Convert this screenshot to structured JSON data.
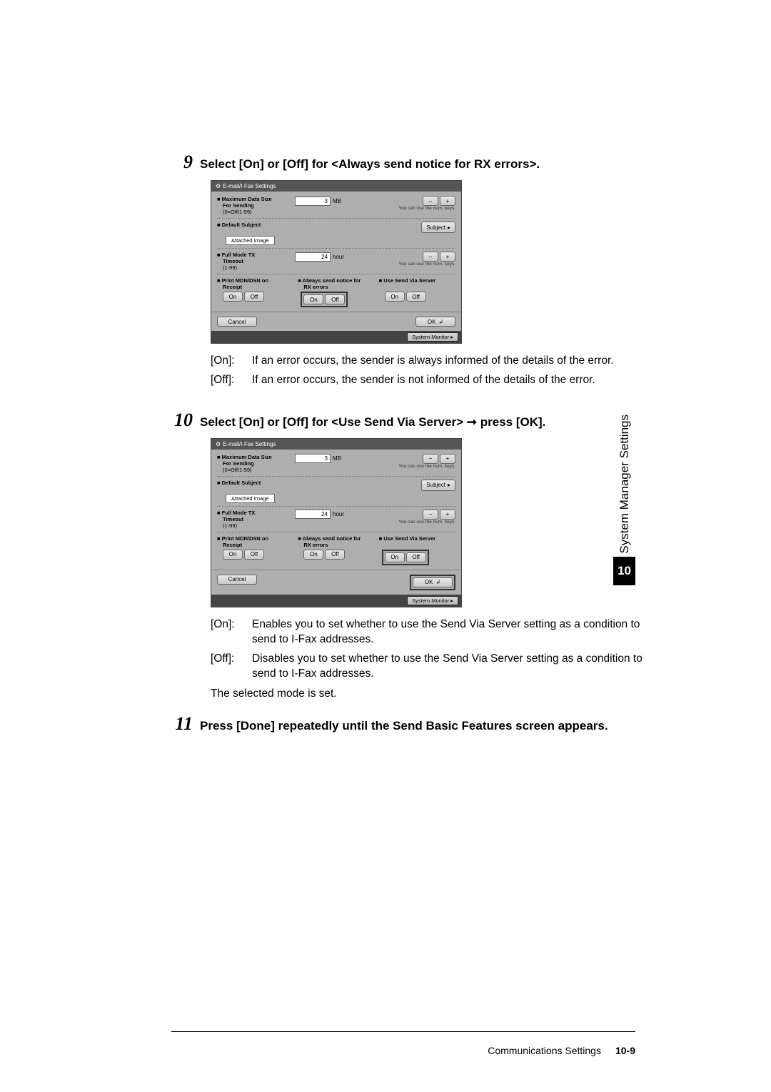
{
  "steps": {
    "s9": {
      "num": "9",
      "title": "Select [On] or [Off] for <Always send notice for RX errors>."
    },
    "s10": {
      "num": "10",
      "title": "Select [On] or [Off] for <Use Send Via Server> ➞ press [OK]."
    },
    "s11": {
      "num": "11",
      "title": "Press [Done] repeatedly until the Send Basic Features screen appears."
    }
  },
  "screenshot": {
    "title": "E-mail/I-Fax Settings",
    "max_data": {
      "label1": "Maximum Data Size",
      "label2": "For Sending",
      "range": "(0=Off/1-99)",
      "value": "3",
      "unit": "MB",
      "hint": "You can use the num. keys."
    },
    "subject": {
      "label": "Default Subject",
      "value": "Attached Image",
      "btn": "Subject"
    },
    "fullmode": {
      "label1": "Full Mode TX",
      "label2": "Timeout",
      "range": "(1-99)",
      "value": "24",
      "unit": "hour",
      "hint": "You can use the num. keys."
    },
    "triple": {
      "col1": {
        "label1": "Print MDN/DSN on",
        "label2": "Receipt"
      },
      "col2": {
        "label1": "Always send notice for",
        "label2": "RX errors"
      },
      "col3": {
        "label": "Use Send Via Server"
      }
    },
    "onoff": {
      "on": "On",
      "off": "Off"
    },
    "minus": "−",
    "plus": "+",
    "cancel": "Cancel",
    "ok": "OK",
    "status": "System Monitor"
  },
  "desc9": {
    "on_label": "[On]:",
    "on_text": "If an error occurs, the sender is always informed of the details of the error.",
    "off_label": "[Off]:",
    "off_text": "If an error occurs, the sender is not informed of the details of the error."
  },
  "desc10": {
    "on_label": "[On]:",
    "on_text": "Enables you to set whether to use the Send Via Server setting as a condition to send to I-Fax addresses.",
    "off_label": "[Off]:",
    "off_text": "Disables you to set whether to use the Send Via Server setting as a condition to send to I-Fax addresses.",
    "note": "The selected mode is set."
  },
  "side": {
    "label": "System Manager Settings",
    "chapter": "10"
  },
  "footer": {
    "section": "Communications Settings",
    "page": "10-9"
  }
}
